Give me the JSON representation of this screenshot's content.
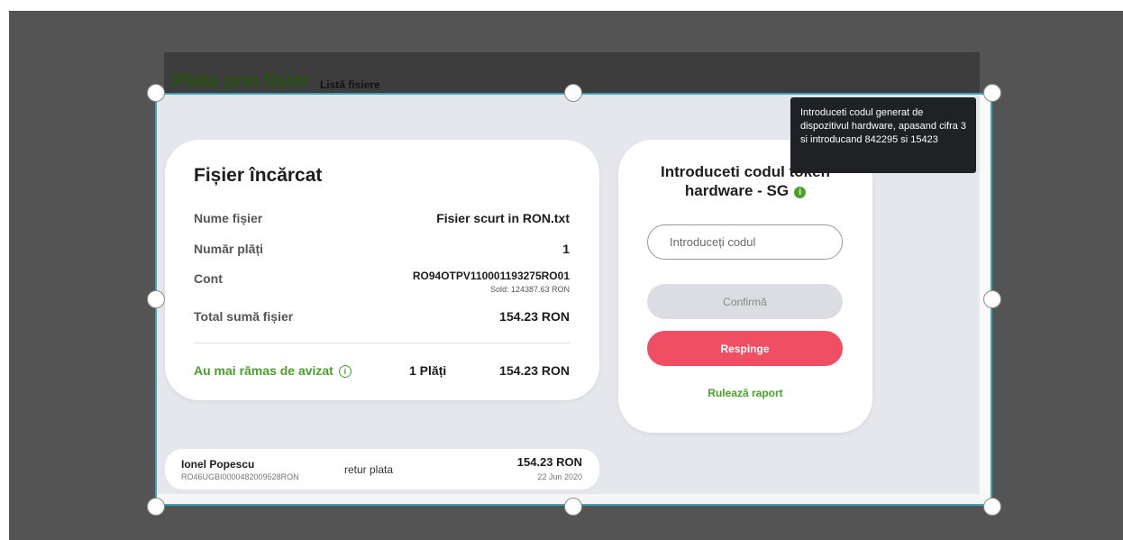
{
  "page": {
    "title": "Plata prin fișier",
    "list_link": "Listă fisiere"
  },
  "file_card": {
    "title": "Fișier încărcat",
    "rows": [
      {
        "label": "Nume fișier",
        "value": "Fisier scurt in RON.txt"
      },
      {
        "label": "Număr plăți",
        "value": "1"
      },
      {
        "label": "Cont",
        "value": "RO94OTPV110001193275RO01",
        "sub": "Sold: 124387.63 RON"
      },
      {
        "label": "Total sumă fișier",
        "value": "154.23 RON"
      }
    ],
    "remaining": {
      "label": "Au mai rămas de avizat",
      "info_icon": "info-icon",
      "count": "1 Plăți",
      "amount": "154.23 RON"
    }
  },
  "token_card": {
    "title_line1": "Introduceti codul token",
    "title_line2": "hardware - SG",
    "info_icon": "info-icon",
    "input_placeholder": "Introduceți codul",
    "confirm_label": "Confirmă",
    "reject_label": "Respinge",
    "report_label": "Rulează raport"
  },
  "transaction": {
    "name": "Ionel Popescu",
    "iban": "RO46UGBI0000482009528RON",
    "description": "retur plata",
    "amount": "154.23 RON",
    "date": "22 Jun 2020"
  },
  "tooltip": {
    "text": "Introduceti codul generat de dispozitivul hardware, apasand cifra 3 si introducand 842295 si 15423"
  },
  "colors": {
    "accent_green": "#4aa12a",
    "reject_red": "#f04e63",
    "selection_border": "#3ea1b6",
    "title_green": "#27530f"
  }
}
